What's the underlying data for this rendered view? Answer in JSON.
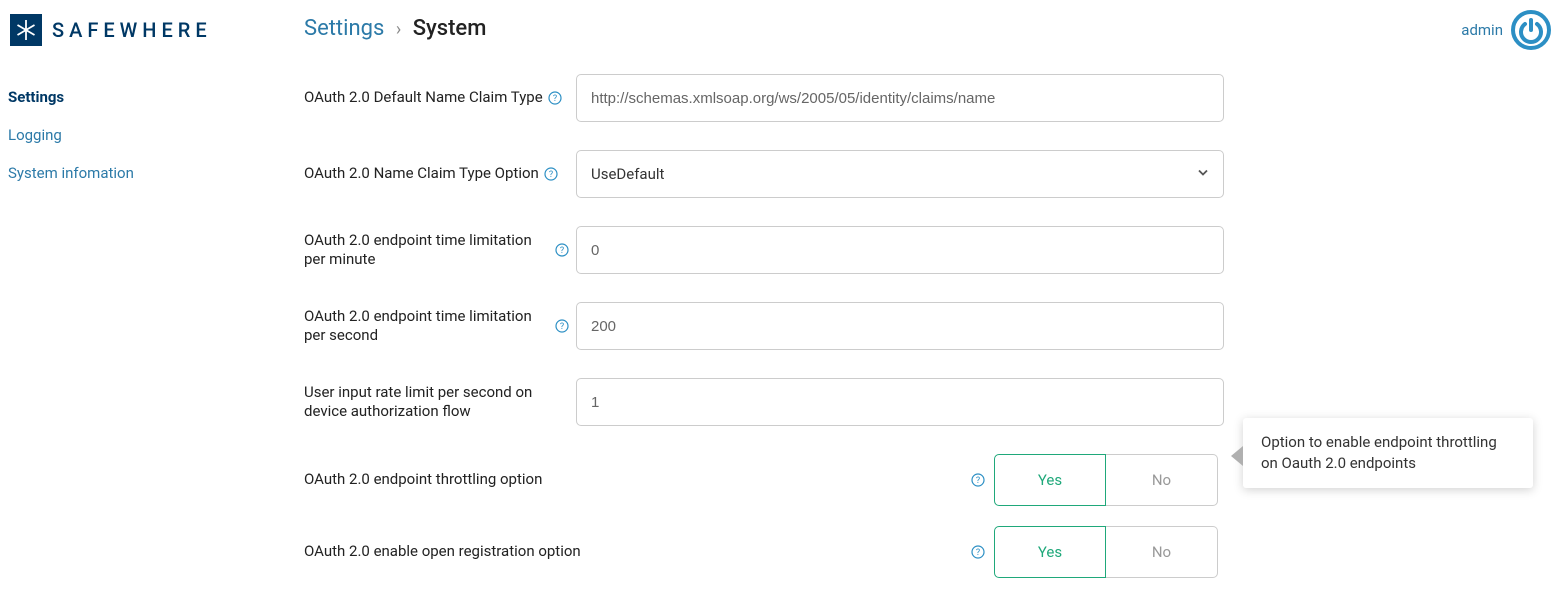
{
  "brand": "SAFEWHERE",
  "breadcrumb": {
    "parent": "Settings",
    "current": "System"
  },
  "user": {
    "name": "admin"
  },
  "sidebar": {
    "items": [
      {
        "label": "Settings",
        "active": true
      },
      {
        "label": "Logging",
        "active": false
      },
      {
        "label": "System infomation",
        "active": false
      }
    ]
  },
  "form": {
    "row0": {
      "label": "OAuth 2.0 Default Name Claim Type",
      "value": "http://schemas.xmlsoap.org/ws/2005/05/identity/claims/name"
    },
    "row1": {
      "label": "OAuth 2.0 Name Claim Type Option",
      "value": "UseDefault"
    },
    "row2": {
      "label": "OAuth 2.0 endpoint time limitation per minute",
      "value": "0"
    },
    "row3": {
      "label": "OAuth 2.0 endpoint time limitation per second",
      "value": "200"
    },
    "row4": {
      "label": "User input rate limit per second on device authorization flow",
      "value": "1"
    },
    "row5": {
      "label": "OAuth 2.0 endpoint throttling option",
      "yes": "Yes",
      "no": "No",
      "selected": "Yes"
    },
    "row6": {
      "label": "OAuth 2.0 enable open registration option",
      "yes": "Yes",
      "no": "No",
      "selected": "Yes"
    }
  },
  "tooltip": {
    "text": "Option to enable endpoint throttling on Oauth 2.0 endpoints"
  }
}
